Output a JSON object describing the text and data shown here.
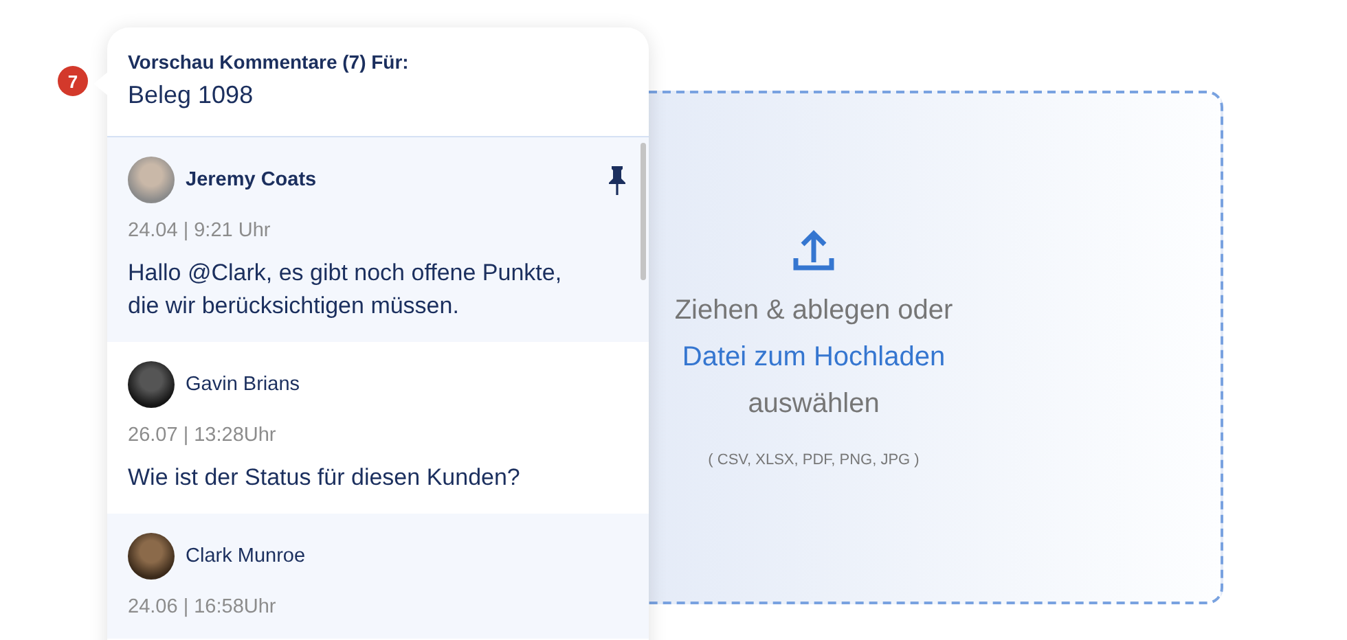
{
  "badge": {
    "count": "7"
  },
  "preview": {
    "title": "Vorschau Kommentare (7) Für:",
    "subject": "Beleg 1098",
    "comments": [
      {
        "author": "Jeremy Coats",
        "date": "24.04 | 9:21 Uhr",
        "text": "Hallo @Clark, es gibt noch offene Punkte, die wir berücksichtigen müssen.",
        "pinned": true,
        "unread": true
      },
      {
        "author": "Gavin Brians",
        "date": "26.07 | 13:28Uhr",
        "text": "Wie ist der Status für diesen Kunden?",
        "pinned": false,
        "unread": false
      },
      {
        "author": "Clark Munroe",
        "date": "24.06 | 16:58Uhr",
        "pinned": false,
        "unread": false
      }
    ]
  },
  "upload": {
    "text_before": "Ziehen & ablegen oder",
    "link": "Datei zum Hochladen",
    "text_after": "auswählen",
    "formats": "( CSV, XLSX, PDF, PNG, JPG )"
  }
}
